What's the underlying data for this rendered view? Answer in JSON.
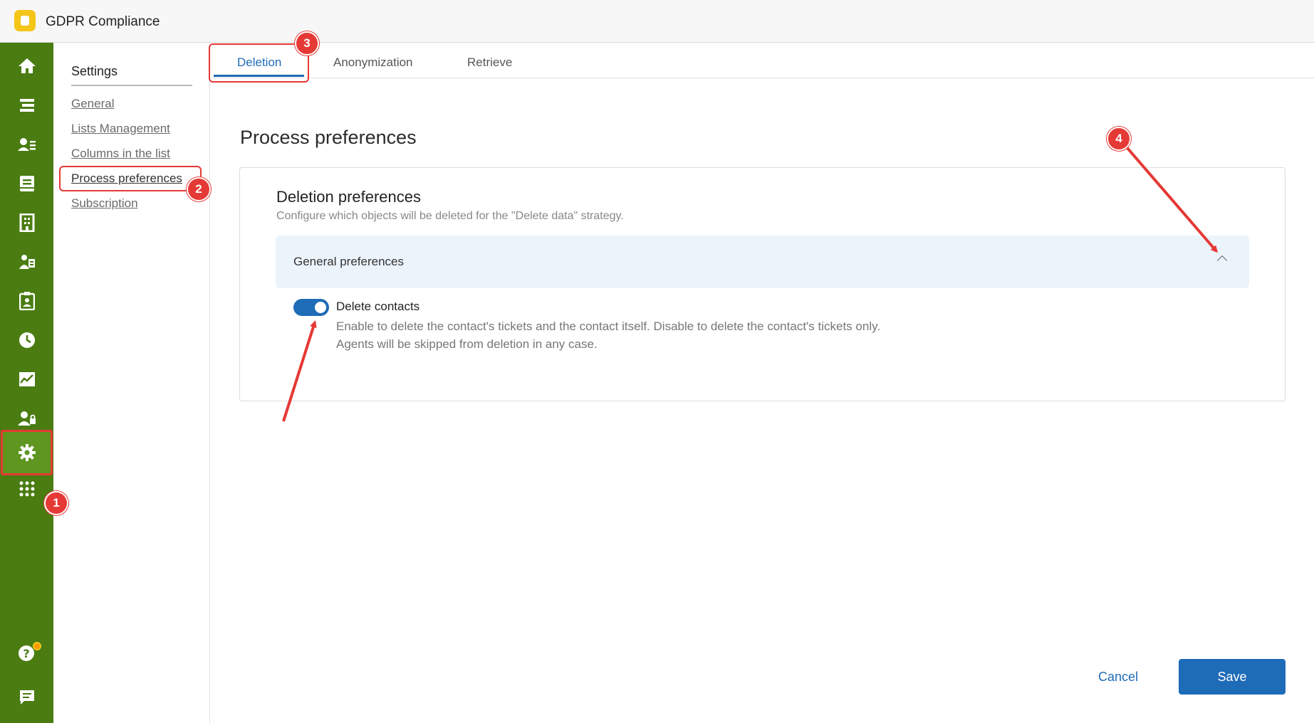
{
  "app": {
    "title": "GDPR Compliance"
  },
  "rail": {
    "icons": [
      "home-icon",
      "tickets-icon",
      "contacts-icon",
      "knowledge-icon",
      "companies-icon",
      "assets-icon",
      "badge-icon",
      "clock-icon",
      "analytics-icon",
      "agents-icon",
      "gear-icon",
      "apps-icon",
      "help-icon",
      "chat-icon"
    ]
  },
  "settings": {
    "title": "Settings",
    "links": [
      "General",
      "Lists Management",
      "Columns in the list",
      "Process preferences",
      "Subscription"
    ]
  },
  "tabs": [
    "Deletion",
    "Anonymization",
    "Retrieve"
  ],
  "main": {
    "page_title": "Process preferences",
    "card": {
      "title": "Deletion preferences",
      "subtitle": "Configure which objects will be deleted for the \"Delete data\" strategy.",
      "accordion_label": "General preferences",
      "toggle": {
        "label": "Delete contacts",
        "desc_line1": "Enable to delete the contact's tickets and the contact itself. Disable to delete the contact's tickets only.",
        "desc_line2": "Agents will be skipped from deletion in any case.",
        "enabled": true
      }
    }
  },
  "actions": {
    "cancel": "Cancel",
    "save": "Save"
  },
  "annotations": [
    "1",
    "2",
    "3",
    "4"
  ],
  "colors": {
    "rail": "#4a7c12",
    "accent": "#1e6bb8",
    "annotation": "#e53935"
  }
}
